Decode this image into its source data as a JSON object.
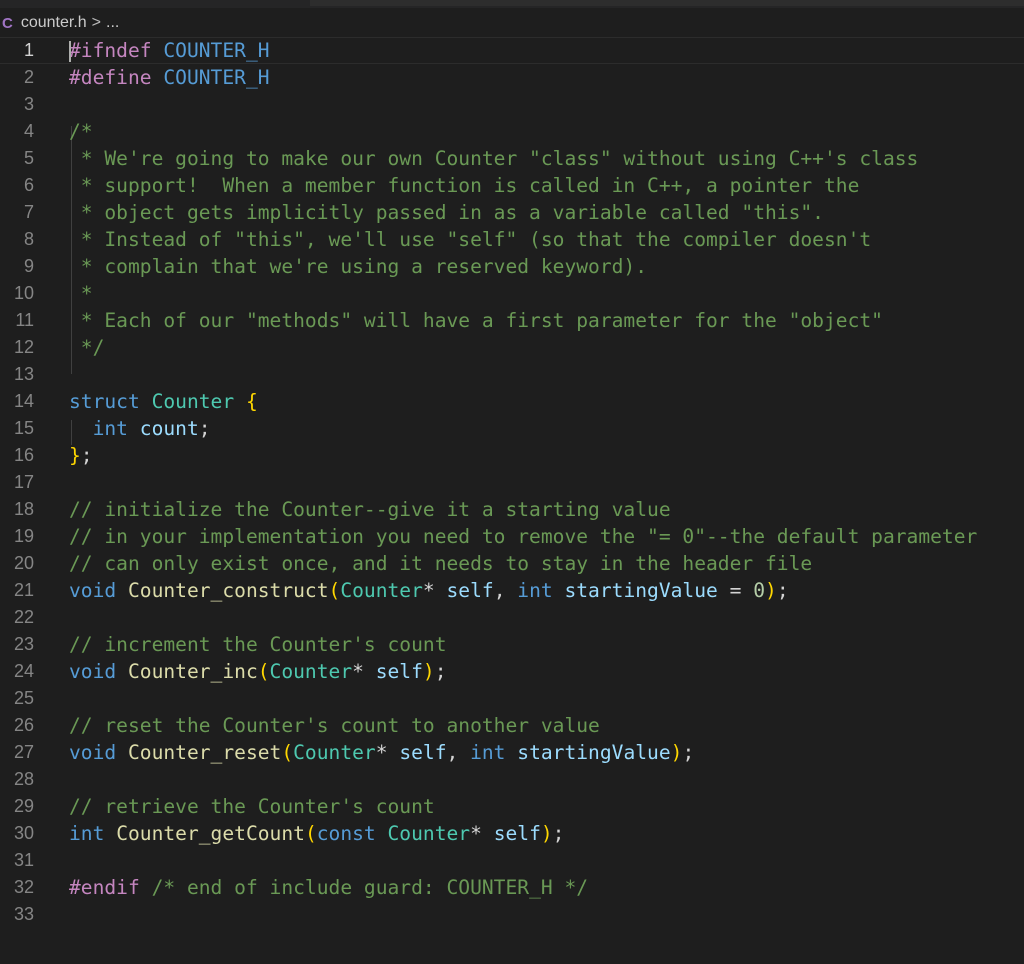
{
  "window": {
    "file_name": "counter.h",
    "breadcrumb_sep": ">",
    "breadcrumb_more": "...",
    "file_icon": "C"
  },
  "colors": {
    "background": "#1e1e1e",
    "preprocessor": "#c586c0",
    "keyword": "#569cd6",
    "comment": "#6a9955",
    "type": "#4ec9b0",
    "function": "#dcdcaa",
    "variable": "#9cdcfe",
    "number": "#b5cea8",
    "bracket": "#ffd700"
  },
  "editor": {
    "active_line": 1,
    "lines": [
      {
        "n": "1",
        "tokens": [
          {
            "t": "#ifndef",
            "c": "pre"
          },
          {
            "t": " "
          },
          {
            "t": "COUNTER_H",
            "c": "macro"
          }
        ]
      },
      {
        "n": "2",
        "tokens": [
          {
            "t": "#define",
            "c": "pre"
          },
          {
            "t": " "
          },
          {
            "t": "COUNTER_H",
            "c": "macro"
          }
        ]
      },
      {
        "n": "3",
        "tokens": []
      },
      {
        "n": "4",
        "tokens": [
          {
            "t": "/*",
            "c": "com"
          }
        ]
      },
      {
        "n": "5",
        "tokens": [
          {
            "t": " * We're going to make our own Counter \"class\" without using C++'s class",
            "c": "com"
          }
        ]
      },
      {
        "n": "6",
        "tokens": [
          {
            "t": " * support!  When a member function is called in C++, a pointer the",
            "c": "com"
          }
        ]
      },
      {
        "n": "7",
        "tokens": [
          {
            "t": " * object gets implicitly passed in as a variable called \"this\".",
            "c": "com"
          }
        ]
      },
      {
        "n": "8",
        "tokens": [
          {
            "t": " * Instead of \"this\", we'll use \"self\" (so that the compiler doesn't",
            "c": "com"
          }
        ]
      },
      {
        "n": "9",
        "tokens": [
          {
            "t": " * complain that we're using a reserved keyword).",
            "c": "com"
          }
        ]
      },
      {
        "n": "10",
        "tokens": [
          {
            "t": " *",
            "c": "com"
          }
        ]
      },
      {
        "n": "11",
        "tokens": [
          {
            "t": " * Each of our \"methods\" will have a first parameter for the \"object\"",
            "c": "com"
          }
        ]
      },
      {
        "n": "12",
        "tokens": [
          {
            "t": " */",
            "c": "com"
          }
        ]
      },
      {
        "n": "13",
        "tokens": []
      },
      {
        "n": "14",
        "tokens": [
          {
            "t": "struct",
            "c": "kw"
          },
          {
            "t": " "
          },
          {
            "t": "Counter",
            "c": "type"
          },
          {
            "t": " "
          },
          {
            "t": "{",
            "c": "p1"
          }
        ]
      },
      {
        "n": "15",
        "tokens": [
          {
            "t": "  "
          },
          {
            "t": "int",
            "c": "kw"
          },
          {
            "t": " "
          },
          {
            "t": "count",
            "c": "var"
          },
          {
            "t": ";",
            "c": "op"
          }
        ]
      },
      {
        "n": "16",
        "tokens": [
          {
            "t": "}",
            "c": "p1"
          },
          {
            "t": ";",
            "c": "op"
          }
        ]
      },
      {
        "n": "17",
        "tokens": []
      },
      {
        "n": "18",
        "tokens": [
          {
            "t": "// initialize the Counter--give it a starting value",
            "c": "com"
          }
        ]
      },
      {
        "n": "19",
        "tokens": [
          {
            "t": "// in your implementation you need to remove the \"= 0\"--the default parameter",
            "c": "com"
          }
        ]
      },
      {
        "n": "20",
        "tokens": [
          {
            "t": "// can only exist once, and it needs to stay in the header file",
            "c": "com"
          }
        ]
      },
      {
        "n": "21",
        "tokens": [
          {
            "t": "void",
            "c": "kw"
          },
          {
            "t": " "
          },
          {
            "t": "Counter_construct",
            "c": "fn"
          },
          {
            "t": "(",
            "c": "p1"
          },
          {
            "t": "Counter",
            "c": "type"
          },
          {
            "t": "*",
            "c": "op"
          },
          {
            "t": " "
          },
          {
            "t": "self",
            "c": "var"
          },
          {
            "t": ", ",
            "c": "op"
          },
          {
            "t": "int",
            "c": "kw"
          },
          {
            "t": " "
          },
          {
            "t": "startingValue",
            "c": "var"
          },
          {
            "t": " = ",
            "c": "op"
          },
          {
            "t": "0",
            "c": "num"
          },
          {
            "t": ")",
            "c": "p1"
          },
          {
            "t": ";",
            "c": "op"
          }
        ]
      },
      {
        "n": "22",
        "tokens": []
      },
      {
        "n": "23",
        "tokens": [
          {
            "t": "// increment the Counter's count",
            "c": "com"
          }
        ]
      },
      {
        "n": "24",
        "tokens": [
          {
            "t": "void",
            "c": "kw"
          },
          {
            "t": " "
          },
          {
            "t": "Counter_inc",
            "c": "fn"
          },
          {
            "t": "(",
            "c": "p1"
          },
          {
            "t": "Counter",
            "c": "type"
          },
          {
            "t": "*",
            "c": "op"
          },
          {
            "t": " "
          },
          {
            "t": "self",
            "c": "var"
          },
          {
            "t": ")",
            "c": "p1"
          },
          {
            "t": ";",
            "c": "op"
          }
        ]
      },
      {
        "n": "25",
        "tokens": []
      },
      {
        "n": "26",
        "tokens": [
          {
            "t": "// reset the Counter's count to another value",
            "c": "com"
          }
        ]
      },
      {
        "n": "27",
        "tokens": [
          {
            "t": "void",
            "c": "kw"
          },
          {
            "t": " "
          },
          {
            "t": "Counter_reset",
            "c": "fn"
          },
          {
            "t": "(",
            "c": "p1"
          },
          {
            "t": "Counter",
            "c": "type"
          },
          {
            "t": "*",
            "c": "op"
          },
          {
            "t": " "
          },
          {
            "t": "self",
            "c": "var"
          },
          {
            "t": ", ",
            "c": "op"
          },
          {
            "t": "int",
            "c": "kw"
          },
          {
            "t": " "
          },
          {
            "t": "startingValue",
            "c": "var"
          },
          {
            "t": ")",
            "c": "p1"
          },
          {
            "t": ";",
            "c": "op"
          }
        ]
      },
      {
        "n": "28",
        "tokens": []
      },
      {
        "n": "29",
        "tokens": [
          {
            "t": "// retrieve the Counter's count",
            "c": "com"
          }
        ]
      },
      {
        "n": "30",
        "tokens": [
          {
            "t": "int",
            "c": "kw"
          },
          {
            "t": " "
          },
          {
            "t": "Counter_getCount",
            "c": "fn"
          },
          {
            "t": "(",
            "c": "p1"
          },
          {
            "t": "const",
            "c": "kw"
          },
          {
            "t": " "
          },
          {
            "t": "Counter",
            "c": "type"
          },
          {
            "t": "*",
            "c": "op"
          },
          {
            "t": " "
          },
          {
            "t": "self",
            "c": "var"
          },
          {
            "t": ")",
            "c": "p1"
          },
          {
            "t": ";",
            "c": "op"
          }
        ]
      },
      {
        "n": "31",
        "tokens": []
      },
      {
        "n": "32",
        "tokens": [
          {
            "t": "#endif",
            "c": "pre"
          },
          {
            "t": " "
          },
          {
            "t": "/* end of include guard: COUNTER_H */",
            "c": "com"
          }
        ]
      },
      {
        "n": "33",
        "tokens": []
      }
    ]
  }
}
